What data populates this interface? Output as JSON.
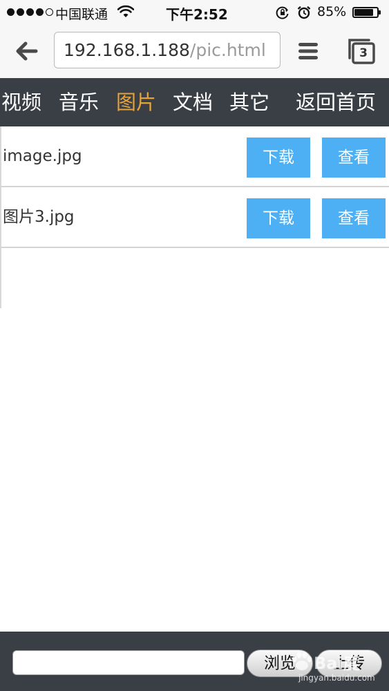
{
  "status_bar": {
    "carrier": "中国联通",
    "time": "下午2:52",
    "battery_percent_label": "85%",
    "battery_level": 0.85,
    "signal_bars_filled": 4,
    "signal_bars_total": 5
  },
  "browser": {
    "url_host": "192.168.1.188",
    "url_path": "/pic.html",
    "tab_count": "3"
  },
  "nav": {
    "items": [
      {
        "label": "视频",
        "active": false
      },
      {
        "label": "音乐",
        "active": false
      },
      {
        "label": "图片",
        "active": true
      },
      {
        "label": "文档",
        "active": false
      },
      {
        "label": "其它",
        "active": false
      }
    ],
    "home_label": "返回首页",
    "active_color": "#e3a33a",
    "bg_color": "#3a3f46"
  },
  "files": [
    {
      "name": "image.jpg",
      "download_label": "下载",
      "view_label": "查看"
    },
    {
      "name": "图片3.jpg",
      "download_label": "下载",
      "view_label": "查看"
    }
  ],
  "upload": {
    "browse_label": "浏览",
    "upload_label": "上传",
    "file_value": ""
  },
  "accent_color": "#4db0f5",
  "watermark": {
    "logo": "Bai度",
    "site": "jingyan.baidu.com"
  }
}
